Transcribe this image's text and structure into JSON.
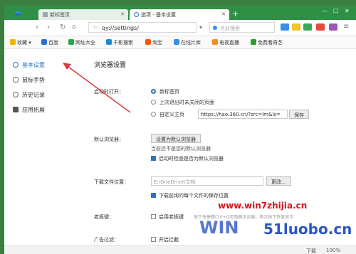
{
  "tabs": [
    {
      "label": "新标签页"
    },
    {
      "label": "选项 - 基本设置"
    }
  ],
  "address": "qy://settings/",
  "search_placeholder": "点此搜索",
  "bookmarks": [
    "收藏",
    "百度",
    "网址大全",
    "千影搜索",
    "淘宝",
    "在线片库",
    "电视直播",
    "免费看奇艺"
  ],
  "sidebar": {
    "items": [
      {
        "label": "基本设置"
      },
      {
        "label": "鼠标手势"
      },
      {
        "label": "历史记录"
      },
      {
        "label": "应用拓展"
      }
    ]
  },
  "main": {
    "title": "浏览器设置",
    "startup": {
      "label": "启动时打开：",
      "options": [
        "新标签页",
        "上次退出时未关闭的页面",
        "自定义主页"
      ],
      "selected": "新标签页",
      "homepage_url": "https://hao.360.cn/?src=lm&ls=",
      "save_label": "保存"
    },
    "default_browser": {
      "label": "默认浏览器：",
      "button": "设置为默认浏览器",
      "note": "当前还不是您的默认浏览器",
      "check_label": "启动时检查是否为默认浏览器",
      "checked": true
    },
    "download": {
      "label": "下载文件位置：",
      "path": "E:\\OneDrive\\文档",
      "change_label": "更改...",
      "check_label": "下载前询问每个文件的保存位置",
      "checked": true
    },
    "boss_key": {
      "label": "老板键：",
      "check_label": "启用老板键",
      "hint": "按下快捷键Ctrl+Q可隐藏浏览器，再次按下恢复显示",
      "checked": false
    },
    "ad_filter": {
      "label": "广告过滤：",
      "check_label": "开启拦截",
      "checked": false
    }
  },
  "status": {
    "download": "下载",
    "zoom": "100%"
  },
  "watermark": {
    "line1": "www.win7zhijia.cn",
    "line2": "51luobo.cn"
  },
  "colors": {
    "titlebar": "#2f8f45",
    "accent": "#2a73c5",
    "arrow": "#e03a3a"
  }
}
